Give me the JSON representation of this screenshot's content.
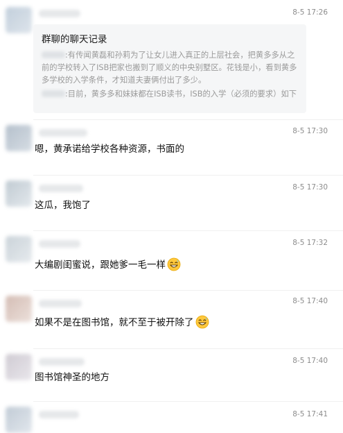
{
  "chat_record": {
    "time": "8-5 17:26",
    "title": "群聊的聊天记录",
    "line1": ":有传闻黄磊和孙莉为了让女儿进入真正的上层社会，把黄多多从之",
    "line2": "前的学校转入了ISB把家也搬到了顺义的中央别墅区。花钱是小，看到黄多",
    "line3": "多学校的入学条件，才知道夫妻俩付出了多少。",
    "line4": ":目前，黄多多和妹妹都在ISB读书，ISB的入学（必须的要求）如下"
  },
  "messages": [
    {
      "time": "8-5 17:30",
      "text": "嗯，黄承诺给学校各种资源，书面的",
      "emoji": ""
    },
    {
      "time": "8-5 17:30",
      "text": "这瓜，我饱了",
      "emoji": ""
    },
    {
      "time": "8-5 17:32",
      "text": "大编剧闺蜜说，跟她爹一毛一样",
      "emoji": "grin-sweat-icon"
    },
    {
      "time": "8-5 17:40",
      "text": "如果不是在图书馆，就不至于被开除了",
      "emoji": "grin-sweat-icon"
    },
    {
      "time": "8-5 17:40",
      "text": "图书馆神圣的地方",
      "emoji": ""
    },
    {
      "time": "8-5 17:41",
      "text": "",
      "emoji": ""
    }
  ],
  "colors": {
    "background": "#ffffff",
    "card": "#f5f6f7",
    "timestamp": "#8c8c8c",
    "text": "#111111",
    "record_text": "#9a9a9a"
  }
}
